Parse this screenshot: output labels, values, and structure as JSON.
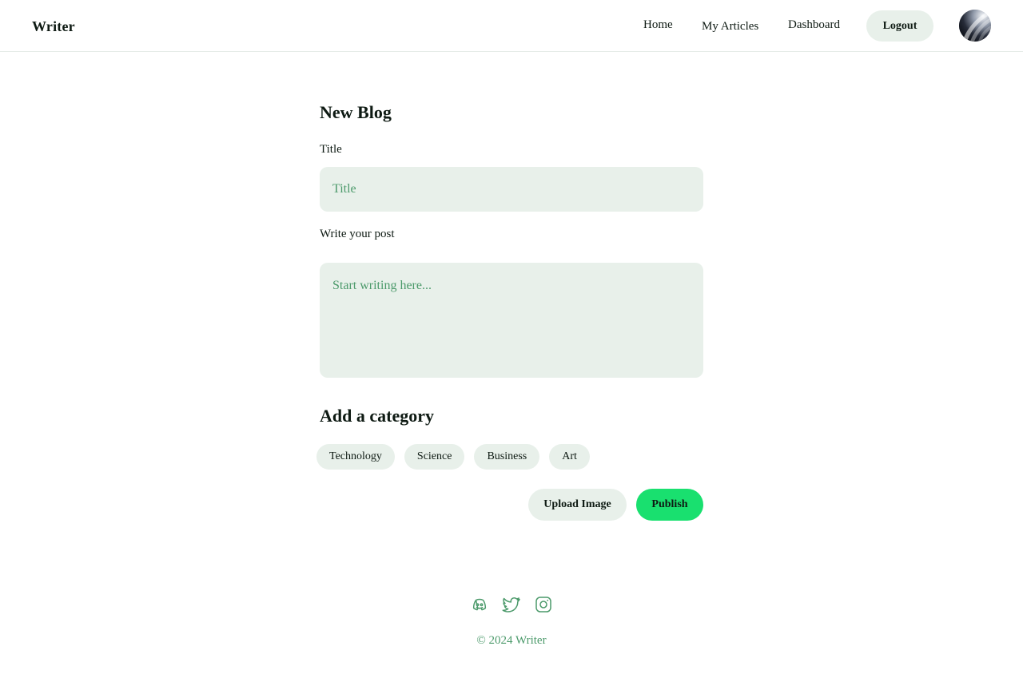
{
  "header": {
    "brand": "Writer",
    "nav": {
      "home": "Home",
      "my_articles": "My Articles",
      "dashboard": "Dashboard"
    },
    "logout_label": "Logout",
    "avatar_icon": "user-avatar"
  },
  "form": {
    "heading": "New Blog",
    "title_label": "Title",
    "title_placeholder": "Title",
    "title_value": "",
    "post_label": "Write your post",
    "post_placeholder": "Start writing here...",
    "post_value": "",
    "category_heading": "Add a category",
    "categories": [
      "Technology",
      "Science",
      "Business",
      "Art"
    ],
    "upload_label": "Upload Image",
    "publish_label": "Publish"
  },
  "footer": {
    "social_icons": [
      "discord-icon",
      "twitter-icon",
      "instagram-icon"
    ],
    "copyright": "© 2024 Writer"
  },
  "colors": {
    "accent": "#19e06f",
    "field_bg": "#e8f0ea",
    "muted_text": "#4c9a6b",
    "text": "#0e1a13"
  }
}
